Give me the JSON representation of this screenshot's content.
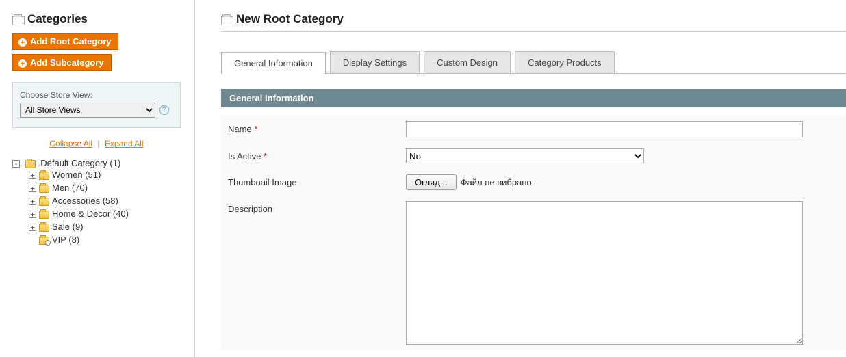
{
  "sidebar": {
    "title": "Categories",
    "addRoot": "Add Root Category",
    "addSub": "Add Subcategory",
    "storeLabel": "Choose Store View:",
    "storeSelected": "All Store Views",
    "collapse": "Collapse All",
    "expand": "Expand All"
  },
  "tree": {
    "root": "Default Category (1)",
    "items": [
      "Women (51)",
      "Men (70)",
      "Accessories (58)",
      "Home & Decor (40)",
      "Sale (9)",
      "VIP (8)"
    ]
  },
  "main": {
    "title": "New Root Category",
    "tabs": [
      "General Information",
      "Display Settings",
      "Custom Design",
      "Category Products"
    ],
    "sectionTitle": "General Information"
  },
  "fields": {
    "name": {
      "label": "Name",
      "value": ""
    },
    "isActive": {
      "label": "Is Active",
      "selected": "No"
    },
    "thumb": {
      "label": "Thumbnail Image",
      "button": "Огляд...",
      "status": "Файл не вибрано."
    },
    "desc": {
      "label": "Description",
      "value": ""
    }
  }
}
